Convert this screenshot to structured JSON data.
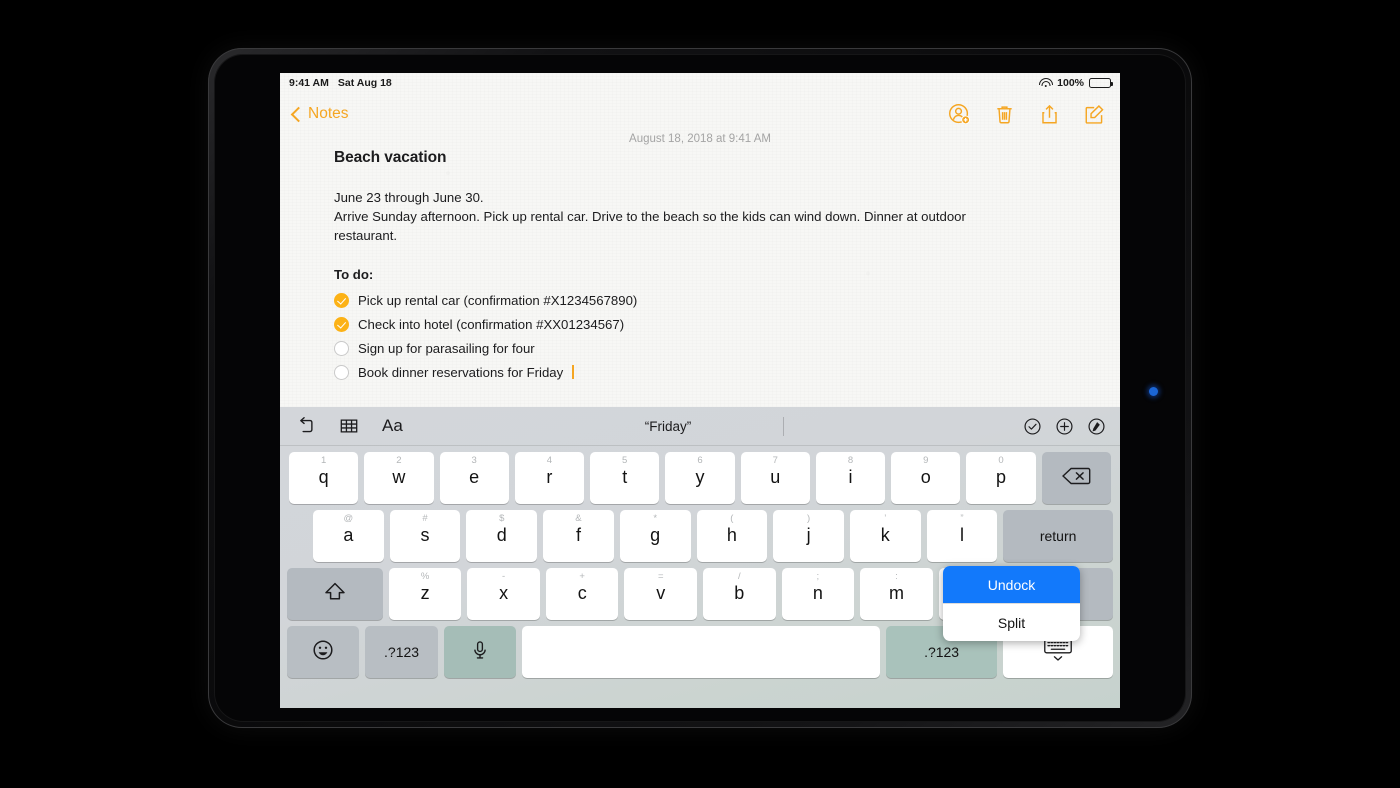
{
  "status_bar": {
    "time": "9:41 AM",
    "date": "Sat Aug 18",
    "battery_percent": "100%",
    "wifi_icon": "wifi-icon",
    "battery_icon": "battery-icon"
  },
  "nav_bar": {
    "back_label": "Notes",
    "back_icon": "chevron-left-icon",
    "actions": [
      {
        "name": "add-person-icon",
        "label": "Add People"
      },
      {
        "name": "trash-icon",
        "label": "Delete"
      },
      {
        "name": "share-icon",
        "label": "Share"
      },
      {
        "name": "compose-icon",
        "label": "New Note"
      }
    ]
  },
  "note": {
    "date": "August 18, 2018 at 9:41 AM",
    "title": "Beach vacation",
    "paragraph_lines": [
      "June 23 through June 30.",
      "Arrive Sunday afternoon. Pick up rental car. Drive to the beach so the kids can wind down. Dinner at outdoor restaurant."
    ],
    "todo_heading": "To do:",
    "todos": [
      {
        "text": "Pick up rental car (confirmation #X1234567890)",
        "checked": true
      },
      {
        "text": "Check into hotel (confirmation #XX01234567)",
        "checked": true
      },
      {
        "text": "Sign up for parasailing for four",
        "checked": false
      },
      {
        "text": "Book dinner reservations for Friday",
        "checked": false,
        "cursor": true
      }
    ]
  },
  "keyboard_toolbar": {
    "undo_icon": "undo-icon",
    "table_icon": "table-icon",
    "format_label": "Aa",
    "prediction": "“Friday”",
    "right_icons": [
      {
        "name": "checklist-circle-icon"
      },
      {
        "name": "plus-circle-icon"
      },
      {
        "name": "markup-pen-circle-icon"
      }
    ]
  },
  "keyboard": {
    "row1": [
      {
        "main": "q",
        "sub": "1"
      },
      {
        "main": "w",
        "sub": "2"
      },
      {
        "main": "e",
        "sub": "3"
      },
      {
        "main": "r",
        "sub": "4"
      },
      {
        "main": "t",
        "sub": "5"
      },
      {
        "main": "y",
        "sub": "6"
      },
      {
        "main": "u",
        "sub": "7"
      },
      {
        "main": "i",
        "sub": "8"
      },
      {
        "main": "o",
        "sub": "9"
      },
      {
        "main": "p",
        "sub": "0"
      }
    ],
    "backspace": {
      "name": "backspace-icon"
    },
    "row2": [
      {
        "main": "a",
        "sub": "@"
      },
      {
        "main": "s",
        "sub": "#"
      },
      {
        "main": "d",
        "sub": "$"
      },
      {
        "main": "f",
        "sub": "&"
      },
      {
        "main": "g",
        "sub": "*"
      },
      {
        "main": "h",
        "sub": "("
      },
      {
        "main": "j",
        "sub": ")"
      },
      {
        "main": "k",
        "sub": "’"
      },
      {
        "main": "l",
        "sub": "”"
      }
    ],
    "return_label": "return",
    "shift": {
      "name": "shift-icon"
    },
    "row3": [
      {
        "main": "z",
        "sub": "%"
      },
      {
        "main": "x",
        "sub": "-"
      },
      {
        "main": "c",
        "sub": "+"
      },
      {
        "main": "v",
        "sub": "="
      },
      {
        "main": "b",
        "sub": "/"
      },
      {
        "main": "n",
        "sub": ";"
      },
      {
        "main": "m",
        "sub": ":"
      }
    ],
    "punct_key": {
      "up": "!",
      "dn": ","
    },
    "shift_right": {
      "name": "shift-icon"
    },
    "bottom": {
      "emoji_icon": "emoji-icon",
      "numbers_left_label": ".?123",
      "mic_icon": "microphone-icon",
      "space_label": "",
      "numbers_right_label": ".?123",
      "dismiss_icon": "hide-keyboard-icon"
    }
  },
  "popup_menu": {
    "items": [
      {
        "label": "Undock",
        "selected": true
      },
      {
        "label": "Split",
        "selected": false
      }
    ]
  },
  "colors": {
    "accent_orange": "#f5a623",
    "check_yellow": "#fcb216",
    "popup_blue": "#1279fb",
    "key_white": "#ffffff",
    "key_gray": "#b4bac0",
    "keyboard_bg": "#d0d5d6"
  }
}
